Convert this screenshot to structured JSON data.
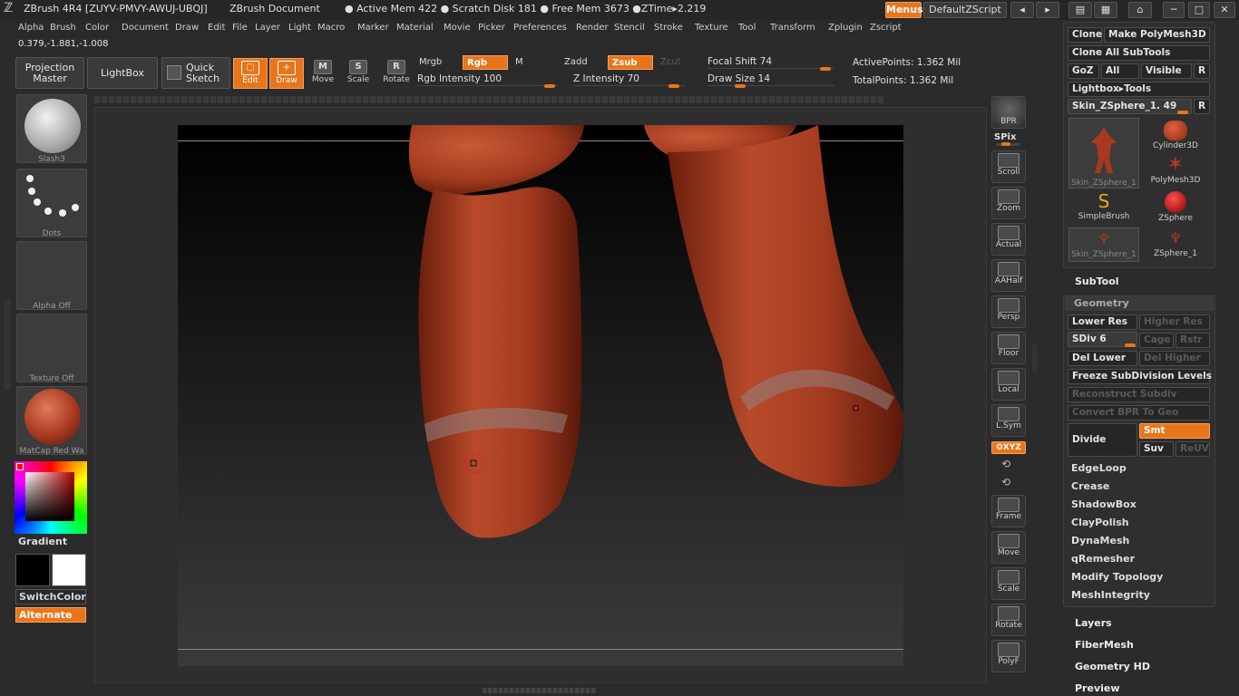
{
  "titlebar": {
    "app": "ZBrush 4R4 [ZUYV-PMVY-AWUJ-UBQJ]",
    "doc": "ZBrush Document",
    "mem": "● Active Mem 422 ● Scratch Disk 181 ● Free Mem 3673 ●ZTime▸2.219",
    "menus_btn": "Menus",
    "script_btn": "DefaultZScript"
  },
  "menubar": [
    "Alpha",
    "Brush",
    "Color",
    "Document",
    "Draw",
    "Edit",
    "File",
    "Layer",
    "Light",
    "Macro",
    "Marker",
    "Material",
    "Movie",
    "Picker",
    "Preferences",
    "Render",
    "Stencil",
    "Stroke",
    "Texture",
    "Tool",
    "Transform",
    "Zplugin",
    "Zscript"
  ],
  "coords": "0.379,-1.881,-1.008",
  "shelf": {
    "projection_master": "Projection Master",
    "lightbox": "LightBox",
    "quick_sketch": "Quick Sketch",
    "edit": "Edit",
    "draw": "Draw",
    "move": "Move",
    "scale": "Scale",
    "rotate": "Rotate",
    "mrgb": "Mrgb",
    "rgb": "Rgb",
    "m": "M",
    "zadd": "Zadd",
    "zsub": "Zsub",
    "zcut": "Zcut",
    "rgb_intensity": "Rgb Intensity 100",
    "z_intensity": "Z Intensity 70",
    "focal_shift": "Focal Shift 74",
    "draw_size": "Draw Size 14",
    "active_points": "ActivePoints: 1.362 Mil",
    "total_points": "TotalPoints: 1.362 Mil",
    "rgb_intensity_value": 100,
    "z_intensity_value": 70,
    "focal_shift_value": 74,
    "draw_size_value": 14
  },
  "left": {
    "brush": "Slash3",
    "stroke": "Dots",
    "alpha": "Alpha  Off",
    "texture": "Texture  Off",
    "material": "MatCap  Red  Wa",
    "gradient": "Gradient",
    "switchcolor": "SwitchColor",
    "alternate": "Alternate"
  },
  "rightbar": {
    "bpr": "BPR",
    "spix": "SPix",
    "scroll": "Scroll",
    "zoom": "Zoom",
    "actual": "Actual",
    "aahalf": "AAHalf",
    "persp": "Persp",
    "floor": "Floor",
    "local": "Local",
    "lsym": "L.Sym",
    "xyz": "❂XYZ",
    "frame": "Frame",
    "move": "Move",
    "scale": "Scale",
    "rotate": "Rotate",
    "polyf": "PolyF"
  },
  "toolpanel": {
    "clone": "Clone",
    "make_polymesh": "Make PolyMesh3D",
    "clone_all": "Clone  All  SubTools",
    "goz": "GoZ",
    "all": "All",
    "visible": "Visible",
    "r": "R",
    "lightbox_tools": "Lightbox▸Tools",
    "current_tool": "Skin_ZSphere_1. 49",
    "tools": [
      {
        "name": "Skin_ZSphere_1"
      },
      {
        "name": "Cylinder3D"
      },
      {
        "name": "PolyMesh3D"
      },
      {
        "name": "SimpleBrush"
      },
      {
        "name": "ZSphere"
      },
      {
        "name": "Skin_ZSphere_1"
      },
      {
        "name": "ZSphere_1"
      }
    ],
    "subtool": "SubTool",
    "geometry": "Geometry",
    "lower_res": "Lower Res",
    "higher_res": "Higher Res",
    "sdiv": "SDiv 6",
    "sdiv_value": 6,
    "cage": "Cage",
    "rstr": "Rstr",
    "del_lower": "Del Lower",
    "del_higher": "Del Higher",
    "freeze": "Freeze SubDivision Levels",
    "reconstruct": "Reconstruct Subdiv",
    "convert_bpr": "Convert BPR To Geo",
    "divide": "Divide",
    "smt": "Smt",
    "suv": "Suv",
    "reuv": "ReUV",
    "geometry_items": [
      "EdgeLoop",
      "Crease",
      "ShadowBox",
      "ClayPolish",
      "DynaMesh",
      "qRemesher",
      "Modify Topology",
      "MeshIntegrity"
    ],
    "palettes": [
      "Layers",
      "FiberMesh",
      "Geometry HD",
      "Preview"
    ]
  },
  "colors": {
    "accent": "#e8751a",
    "bg": "#2b2b2b",
    "model": "#a8391f"
  }
}
